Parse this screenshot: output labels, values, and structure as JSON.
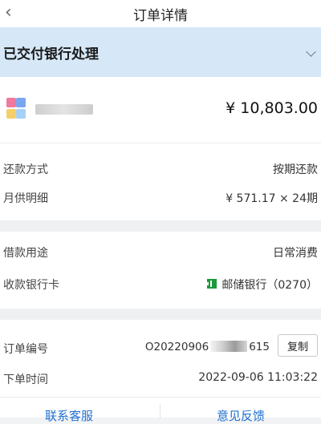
{
  "header": {
    "title": "订单详情"
  },
  "status": {
    "text": "已交付银行处理"
  },
  "product": {
    "amount": "¥ 10,803.00"
  },
  "repayment": {
    "method_label": "还款方式",
    "method_value": "按期还款",
    "monthly_label": "月供明细",
    "monthly_value": "¥ 571.17 × 24期"
  },
  "loan": {
    "purpose_label": "借款用途",
    "purpose_value": "日常消费",
    "card_label": "收款银行卡",
    "card_value": "邮储银行（0270）"
  },
  "order": {
    "number_label": "订单编号",
    "number_prefix": "O20220906",
    "number_suffix": "615",
    "copy_label": "复制",
    "time_label": "下单时间",
    "time_value": "2022-09-06 11:03:22"
  },
  "bottom": {
    "left_link": "联系客服",
    "right_link": "意见反馈"
  },
  "colors": {
    "accent": "#1f6fd1",
    "status_bg": "#d6e8f8",
    "bank_green": "#1a9a3a"
  }
}
